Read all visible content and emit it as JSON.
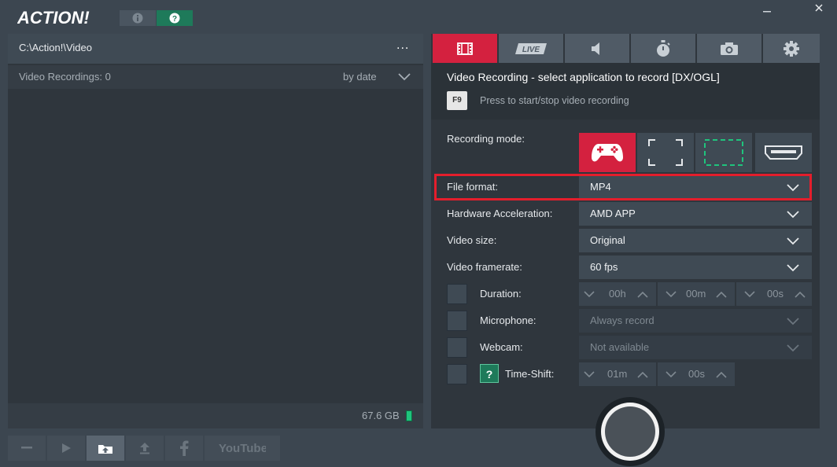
{
  "app": {
    "logo_text": "ACTION!"
  },
  "window": {
    "minimize_glyph": "_",
    "close_glyph": "✕"
  },
  "left": {
    "path": "C:\\Action!\\Video",
    "more_glyph": "...",
    "recordings_label": "Video Recordings: 0",
    "sort_label": "by date",
    "disk_space": "67.6 GB"
  },
  "bottom_toolbar": {
    "youtube_label": "YouTube"
  },
  "tabs": [
    {
      "name": "video",
      "icon": "film-icon"
    },
    {
      "name": "live",
      "icon": "live-badge-icon",
      "label": "LIVE"
    },
    {
      "name": "audio",
      "icon": "speaker-icon"
    },
    {
      "name": "benchmark",
      "icon": "stopwatch-icon"
    },
    {
      "name": "screenshot",
      "icon": "camera-icon"
    },
    {
      "name": "settings",
      "icon": "gear-icon"
    }
  ],
  "panel": {
    "title": "Video Recording - select application to record [DX/OGL]",
    "hotkey": "F9",
    "hotkey_desc": "Press to start/stop video recording",
    "recording_mode_label": "Recording mode:",
    "file_format_label": "File format:",
    "file_format_value": "MP4",
    "hw_accel_label": "Hardware Acceleration:",
    "hw_accel_value": "AMD APP",
    "video_size_label": "Video size:",
    "video_size_value": "Original",
    "framerate_label": "Video framerate:",
    "framerate_value": "60 fps",
    "duration_label": "Duration:",
    "duration_h": "00h",
    "duration_m": "00m",
    "duration_s": "00s",
    "microphone_label": "Microphone:",
    "microphone_value": "Always record",
    "webcam_label": "Webcam:",
    "webcam_value": "Not available",
    "timeshift_help": "?",
    "timeshift_label": "Time-Shift:",
    "timeshift_m": "01m",
    "timeshift_s": "00s"
  },
  "colors": {
    "accent_red": "#d4213f",
    "highlight_red": "#e41e2c",
    "help_green": "#1e7a5a",
    "background": "#3c4650"
  }
}
